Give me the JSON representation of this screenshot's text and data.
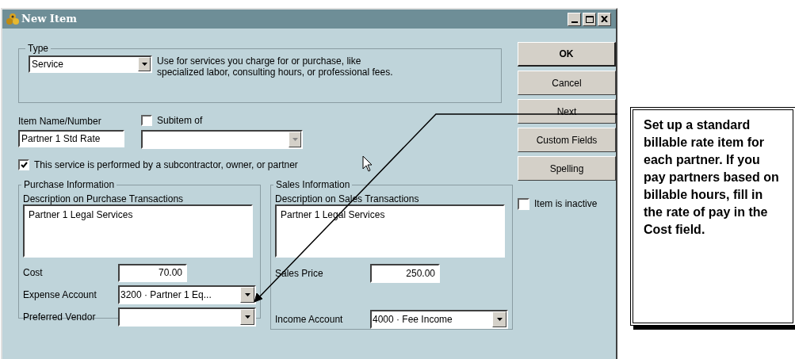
{
  "window": {
    "title": "New Item"
  },
  "type_group": {
    "title": "Type",
    "value": "Service",
    "description": "Use for services you charge for or purchase, like specialized labor, consulting hours, or professional fees."
  },
  "item_name": {
    "label": "Item Name/Number",
    "value": "Partner 1 Std Rate"
  },
  "subitem": {
    "label": "Subitem of",
    "checked": false
  },
  "performed_by_partner": {
    "label": "This service is performed by a subcontractor, owner, or partner",
    "checked": true
  },
  "purchase": {
    "title": "Purchase Information",
    "description_label": "Description on Purchase Transactions",
    "description": "Partner 1 Legal Services",
    "cost_label": "Cost",
    "cost": "70.00",
    "expense_label": "Expense Account",
    "expense_account": "3200 · Partner 1 Eq...",
    "vendor_label": "Preferred Vendor"
  },
  "sales": {
    "title": "Sales Information",
    "description_label": "Description on Sales Transactions",
    "description": "Partner 1 Legal Services",
    "price_label": "Sales Price",
    "price": "250.00",
    "income_label": "Income Account",
    "income_account": "4000 · Fee Income"
  },
  "buttons": [
    {
      "label": "OK",
      "default": true
    },
    {
      "label": "Cancel",
      "default": false
    },
    {
      "label": "Next",
      "default": false
    },
    {
      "label": "Custom Fields",
      "default": false
    },
    {
      "label": "Spelling",
      "default": false
    }
  ],
  "inactive": {
    "label": "Item is inactive",
    "checked": false
  },
  "callout": {
    "text": "Set up a standard billable rate item for each partner. If you pay partners based on billable hours, fill in the rate of pay in the Cost field."
  }
}
